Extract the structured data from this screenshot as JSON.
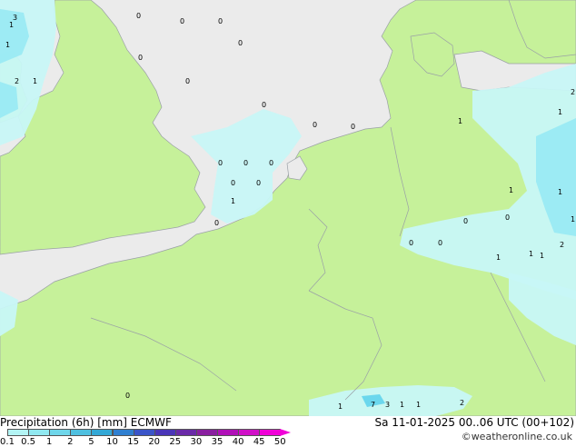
{
  "footer": {
    "title": "Precipitation (6h) [mm] ECMWF",
    "valid": "Sa 11-01-2025 00..06 UTC (00+102)",
    "credit": "©weatheronline.co.uk"
  },
  "colorbar": {
    "ticks": [
      "0.1",
      "0.5",
      "1",
      "2",
      "5",
      "10",
      "15",
      "20",
      "25",
      "30",
      "35",
      "40",
      "45",
      "50"
    ],
    "colors": [
      "#b3f4f4",
      "#90e8f0",
      "#6fd6ea",
      "#4fc0e0",
      "#33a8d6",
      "#2f7fd0",
      "#3a54c8",
      "#4a35b8",
      "#6a2aa8",
      "#8a1fa0",
      "#b010b8",
      "#d010c8",
      "#f000d8"
    ]
  },
  "colors": {
    "land": "#c6f19a",
    "sea": "#ebebeb",
    "precip_light": "#c8f7f7",
    "precip_mid": "#9aeaf3",
    "precip_heavy": "#66d5ec",
    "border": "#9aa0a6"
  },
  "precip_labels": [
    "0",
    "0",
    "0",
    "0",
    "0",
    "0",
    "0",
    "0",
    "0",
    "0",
    "0",
    "0",
    "0",
    "0",
    "0",
    "0",
    "0",
    "0",
    "0",
    "0",
    "1",
    "1",
    "2",
    "3",
    "1",
    "1",
    "1",
    "1",
    "2",
    "7",
    "2",
    "1",
    "1",
    "1",
    "1",
    "1",
    "1",
    "1",
    "1",
    "2",
    "3",
    "1"
  ]
}
